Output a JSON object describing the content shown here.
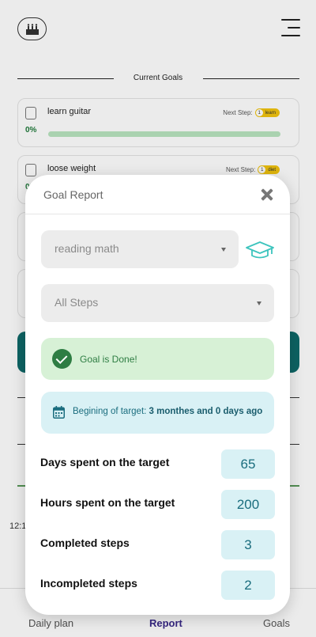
{
  "background": {
    "section_title": "Current Goals",
    "goals": [
      {
        "name": "learn guitar",
        "next_step_label": "Next Step:",
        "step_number": "1",
        "step_name": "learn",
        "progress": "0%"
      },
      {
        "name": "loose weight",
        "next_step_label": "Next Step:",
        "step_number": "1",
        "step_name": "diet",
        "progress": "0%"
      }
    ],
    "time_label": "12:1",
    "nav": {
      "daily_plan": "Daily plan",
      "report": "Report",
      "goals": "Goals"
    }
  },
  "modal": {
    "title": "Goal Report",
    "goal_select": {
      "value": "reading math"
    },
    "steps_select": {
      "value": "All Steps"
    },
    "done_message": "Goal is Done!",
    "begin_label": "Begining of target:",
    "begin_value": "3 monthes and 0 days ago",
    "stats": [
      {
        "label": "Days spent on the target",
        "value": "65"
      },
      {
        "label": "Hours spent on the target",
        "value": "200"
      },
      {
        "label": "Completed steps",
        "value": "3"
      },
      {
        "label": "Incompleted steps",
        "value": "2"
      }
    ]
  },
  "colors": {
    "accent_teal": "#1a6d7e",
    "success_green": "#2e7d43",
    "report_active": "#3a2a8a",
    "icon_teal": "#3cc4bd"
  }
}
